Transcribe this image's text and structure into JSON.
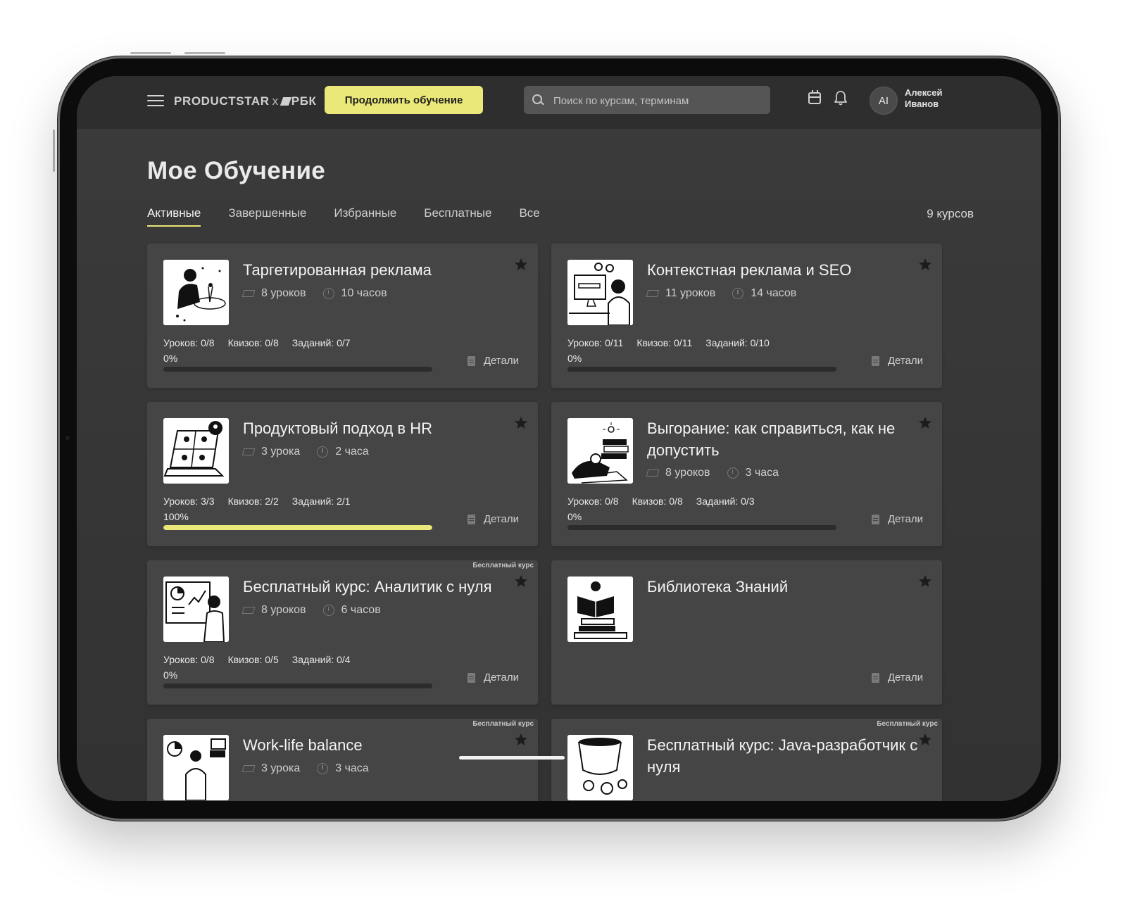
{
  "header": {
    "logo_brand": "PRODUCTSTAR",
    "logo_x": "x",
    "logo_partner": "РБК",
    "continue_label": "Продолжить обучение",
    "search_placeholder": "Поиск по курсам, терминам",
    "avatar_initials": "AI",
    "user_first_name": "Алексей",
    "user_last_name": "Иванов"
  },
  "page": {
    "title": "Мое Обучение",
    "course_count": "9 курсов"
  },
  "tabs": [
    {
      "label": "Активные",
      "active": true
    },
    {
      "label": "Завершенные",
      "active": false
    },
    {
      "label": "Избранные",
      "active": false
    },
    {
      "label": "Бесплатные",
      "active": false
    },
    {
      "label": "Все",
      "active": false
    }
  ],
  "colors": {
    "accent": "#eae878",
    "card_bg": "#454545",
    "screen_bg": "#3b3b3b"
  },
  "courses": [
    {
      "title": "Таргетированная реклама",
      "lessons": "8 уроков",
      "hours": "10 часов",
      "stat_lessons": "Уроков: 0/8",
      "stat_quizzes": "Квизов: 0/8",
      "stat_tasks": "Заданий: 0/7",
      "progress_label": "0%",
      "progress": 0,
      "details": "Детали",
      "badge": "",
      "favorite": true
    },
    {
      "title": "Контекстная реклама и SEO",
      "lessons": "11 уроков",
      "hours": "14 часов",
      "stat_lessons": "Уроков: 0/11",
      "stat_quizzes": "Квизов: 0/11",
      "stat_tasks": "Заданий: 0/10",
      "progress_label": "0%",
      "progress": 0,
      "details": "Детали",
      "badge": "",
      "favorite": true
    },
    {
      "title": "Продуктовый подход в HR",
      "lessons": "3 урока",
      "hours": "2 часа",
      "stat_lessons": "Уроков: 3/3",
      "stat_quizzes": "Квизов: 2/2",
      "stat_tasks": "Заданий: 2/1",
      "progress_label": "100%",
      "progress": 1,
      "details": "Детали",
      "badge": "",
      "favorite": true
    },
    {
      "title": "Выгорание: как справиться, как не допустить",
      "lessons": "8 уроков",
      "hours": "3 часа",
      "stat_lessons": "Уроков: 0/8",
      "stat_quizzes": "Квизов: 0/8",
      "stat_tasks": "Заданий: 0/3",
      "progress_label": "0%",
      "progress": 0,
      "details": "Детали",
      "badge": "",
      "favorite": true
    },
    {
      "title": "Бесплатный курс: Аналитик с нуля",
      "lessons": "8 уроков",
      "hours": "6 часов",
      "stat_lessons": "Уроков: 0/8",
      "stat_quizzes": "Квизов: 0/5",
      "stat_tasks": "Заданий: 0/4",
      "progress_label": "0%",
      "progress": 0,
      "details": "Детали",
      "badge": "Бесплатный курс",
      "favorite": true
    },
    {
      "title": "Библиотека Знаний",
      "details": "Детали",
      "badge": "",
      "favorite": true
    },
    {
      "title": "Work-life balance",
      "lessons": "3 урока",
      "hours": "3 часа",
      "badge": "Бесплатный курс",
      "favorite": true
    },
    {
      "title": "Бесплатный курс: Java-разработчик с нуля",
      "badge": "Бесплатный курс",
      "favorite": true
    }
  ]
}
